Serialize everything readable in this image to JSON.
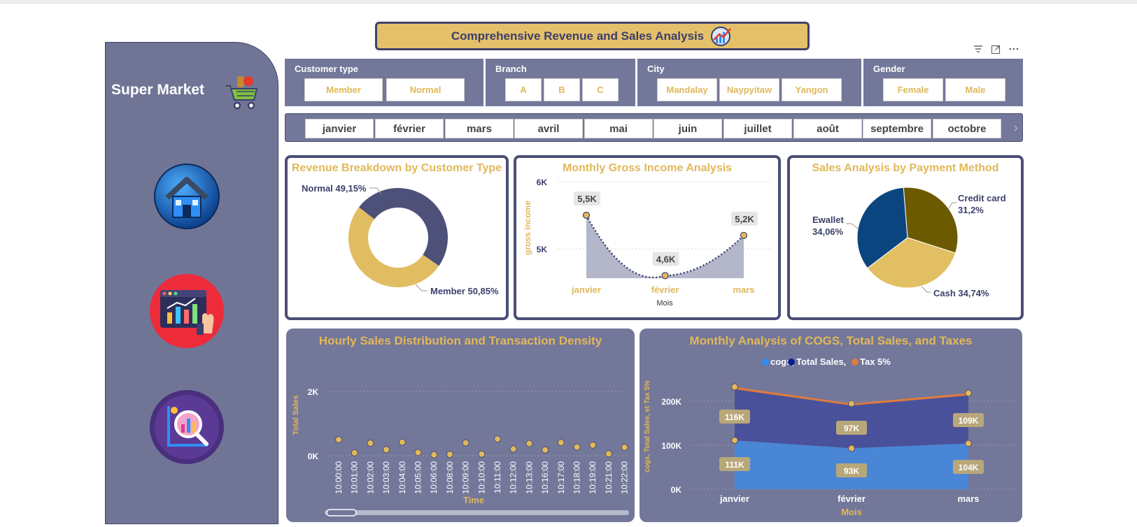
{
  "banner": {
    "title": "Comprehensive Revenue and Sales Analysis"
  },
  "sidebar": {
    "brand": "Super Market"
  },
  "slicers": {
    "customer_type": {
      "title": "Customer type",
      "options": [
        "Member",
        "Normal"
      ]
    },
    "branch": {
      "title": "Branch",
      "options": [
        "A",
        "B",
        "C"
      ]
    },
    "city": {
      "title": "City",
      "options": [
        "Mandalay",
        "Naypyitaw",
        "Yangon"
      ]
    },
    "gender": {
      "title": "Gender",
      "options": [
        "Female",
        "Male"
      ]
    }
  },
  "months": [
    "janvier",
    "février",
    "mars",
    "avril",
    "mai",
    "juin",
    "juillet",
    "août",
    "septembre",
    "octobre"
  ],
  "colors": {
    "accent": "#e1b85a",
    "navy": "#4b4f75",
    "panel": "#737799",
    "sidebar": "#707596"
  },
  "chart_data": [
    {
      "type": "pie",
      "title": "Revenue Breakdown by Customer Type",
      "labels": [
        "Normal",
        "Member"
      ],
      "values": [
        49.15,
        50.85
      ],
      "label_texts": [
        "Normal 49,15%",
        "Member 50,85%"
      ],
      "colors": [
        "#4d5079",
        "#e1bd62"
      ],
      "donut": true
    },
    {
      "type": "area",
      "title": "Monthly Gross Income Analysis",
      "x": [
        "janvier",
        "février",
        "mars"
      ],
      "values": [
        5.5,
        4.6,
        5.2
      ],
      "data_labels": [
        "5,5K",
        "4,6K",
        "5,2K"
      ],
      "ylabel": "gross income",
      "xlabel": "Mois",
      "y_ticks": [
        "6K",
        "5K"
      ]
    },
    {
      "type": "pie",
      "title": "Sales Analysis by Payment Method",
      "labels": [
        "Credit card",
        "Cash",
        "Ewallet"
      ],
      "values": [
        31.2,
        34.74,
        34.06
      ],
      "label_texts": [
        "Credit card",
        "31,2%",
        "Cash 34,74%",
        "Ewallet",
        "34,06%"
      ],
      "colors": [
        "#6b5a00",
        "#e2bf62",
        "#0a4580"
      ]
    },
    {
      "type": "scatter",
      "title": "Hourly Sales Distribution and Transaction Density",
      "x": [
        "10:00:00",
        "10:01:00",
        "10:02:00",
        "10:03:00",
        "10:04:00",
        "10:05:00",
        "10:06:00",
        "10:08:00",
        "10:09:00",
        "10:10:00",
        "10:11:00",
        "10:12:00",
        "10:13:00",
        "10:16:00",
        "10:17:00",
        "10:18:00",
        "10:19:00",
        "10:21:00",
        "10:22:00"
      ],
      "values": [
        500,
        90,
        390,
        190,
        420,
        100,
        30,
        40,
        400,
        50,
        520,
        210,
        380,
        180,
        410,
        270,
        330,
        60,
        260
      ],
      "xlabel": "Time",
      "ylabel": "Total Sales",
      "y_ticks": [
        "2K",
        "0K"
      ],
      "grid": true
    },
    {
      "type": "area",
      "title": "Monthly Analysis of COGS, Total Sales, and Taxes",
      "x": [
        "janvier",
        "février",
        "mars"
      ],
      "legend": [
        "cogs,",
        "Total Sales,",
        "Tax 5%"
      ],
      "legend_colors": [
        "#2f8ef5",
        "#0b1f8a",
        "#e07a3c"
      ],
      "series": [
        {
          "name": "cogs,",
          "values": [
            111,
            93,
            104
          ],
          "labels": [
            "111K",
            "93K",
            "104K"
          ]
        },
        {
          "name": "Total Sales,",
          "values": [
            116,
            97,
            109
          ],
          "labels": [
            "116K",
            "97K",
            "109K"
          ]
        },
        {
          "name": "Tax 5%",
          "values": [
            5.5,
            4.6,
            5.2
          ]
        }
      ],
      "xlabel": "Mois",
      "ylabel": "cogs, Total Sales, et Tax 5%",
      "y_ticks": [
        "200K",
        "100K",
        "0K"
      ],
      "ylim": [
        0,
        250
      ]
    }
  ]
}
